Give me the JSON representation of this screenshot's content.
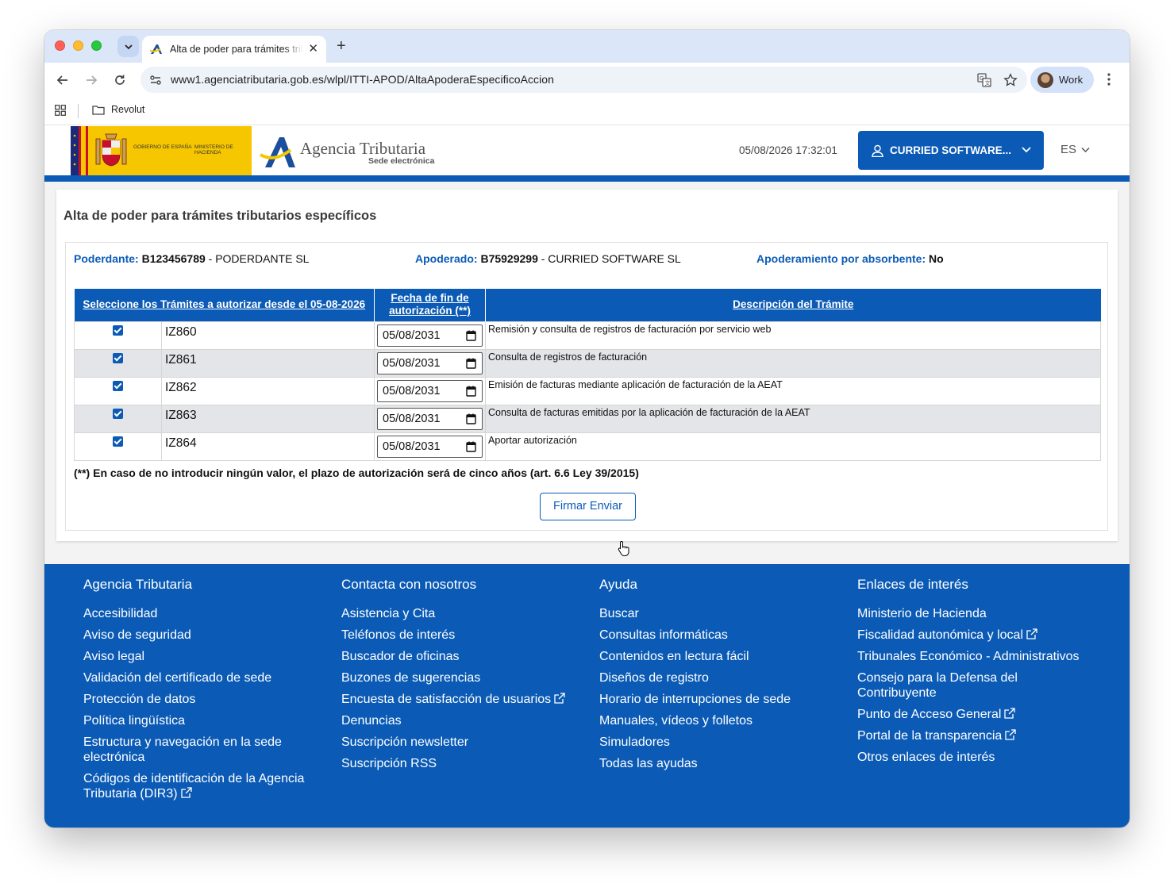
{
  "browser": {
    "tab_title": "Alta de poder para trámites tributarios específicos",
    "url": "www1.agenciatributaria.gob.es/wlpl/ITTI-APOD/AltaApoderaEspecificoAccion",
    "profile_name": "Work",
    "bookmark": "Revolut"
  },
  "header": {
    "gov_line1": "Gobierno de España",
    "gov_line2": "Ministerio de Hacienda",
    "aeat_name": "Agencia Tributaria",
    "aeat_sub": "Sede electrónica",
    "datetime": "05/08/2026 17:32:01",
    "user_button": "CURRIED SOFTWARE...",
    "language": "ES"
  },
  "form": {
    "title": "Alta de poder para trámites tributarios específicos",
    "poderdante_label": "Poderdante:",
    "poderdante_nif": "B123456789",
    "poderdante_name": "- PODERDANTE SL",
    "apoderado_label": "Apoderado:",
    "apoderado_nif": "B75929299",
    "apoderado_name": "- CURRIED SOFTWARE SL",
    "absorbente_label": "Apoderamiento por absorbente:",
    "absorbente_value": "No",
    "columns": [
      "Seleccione los Trámites a autorizar desde el 05-08-2026",
      "Fecha de fin de autorización (**)",
      "Descripción del Trámite"
    ],
    "rows": [
      {
        "code": "IZ860",
        "date": "05/08/2031",
        "desc": "Remisión y consulta de registros de facturación por servicio web",
        "checked": true
      },
      {
        "code": "IZ861",
        "date": "05/08/2031",
        "desc": "Consulta de registros de facturación",
        "checked": true
      },
      {
        "code": "IZ862",
        "date": "05/08/2031",
        "desc": "Emisión de facturas mediante aplicación de facturación de la AEAT",
        "checked": true
      },
      {
        "code": "IZ863",
        "date": "05/08/2031",
        "desc": "Consulta de facturas emitidas por la aplicación de facturación de la AEAT",
        "checked": true
      },
      {
        "code": "IZ864",
        "date": "05/08/2031",
        "desc": "Aportar autorización",
        "checked": true
      }
    ],
    "note": "(**) En caso de no introducir ningún valor, el plazo de autorización será de cinco años (art. 6.6 Ley 39/2015)",
    "submit_label": "Firmar Enviar"
  },
  "footer": {
    "col1": {
      "title": "Agencia Tributaria",
      "links": [
        "Accesibilidad",
        "Aviso de seguridad",
        "Aviso legal",
        "Validación del certificado de sede",
        "Protección de datos",
        "Política lingüística",
        "Estructura y navegación en la sede electrónica",
        "Códigos de identificación de la Agencia Tributaria (DIR3)"
      ]
    },
    "col2": {
      "title": "Contacta con nosotros",
      "links": [
        "Asistencia y Cita",
        "Teléfonos de interés",
        "Buscador de oficinas",
        "Buzones de sugerencias",
        "Encuesta de satisfacción de usuarios",
        "Denuncias",
        "Suscripción newsletter",
        "Suscripción RSS"
      ]
    },
    "col3": {
      "title": "Ayuda",
      "links": [
        "Buscar",
        "Consultas informáticas",
        "Contenidos en lectura fácil",
        "Diseños de registro",
        "Horario de interrupciones de sede",
        "Manuales, vídeos y folletos",
        "Simuladores",
        "Todas las ayudas"
      ]
    },
    "col4": {
      "title": "Enlaces de interés",
      "links": [
        "Ministerio de Hacienda",
        "Fiscalidad autonómica y local",
        "Tribunales Económico - Administrativos",
        "Consejo para la Defensa del Contribuyente",
        "Punto de Acceso General",
        "Portal de la transparencia",
        "Otros enlaces de interés"
      ]
    }
  },
  "colors": {
    "brand_blue": "#0b5bb6",
    "gov_yellow": "#f6c600"
  }
}
